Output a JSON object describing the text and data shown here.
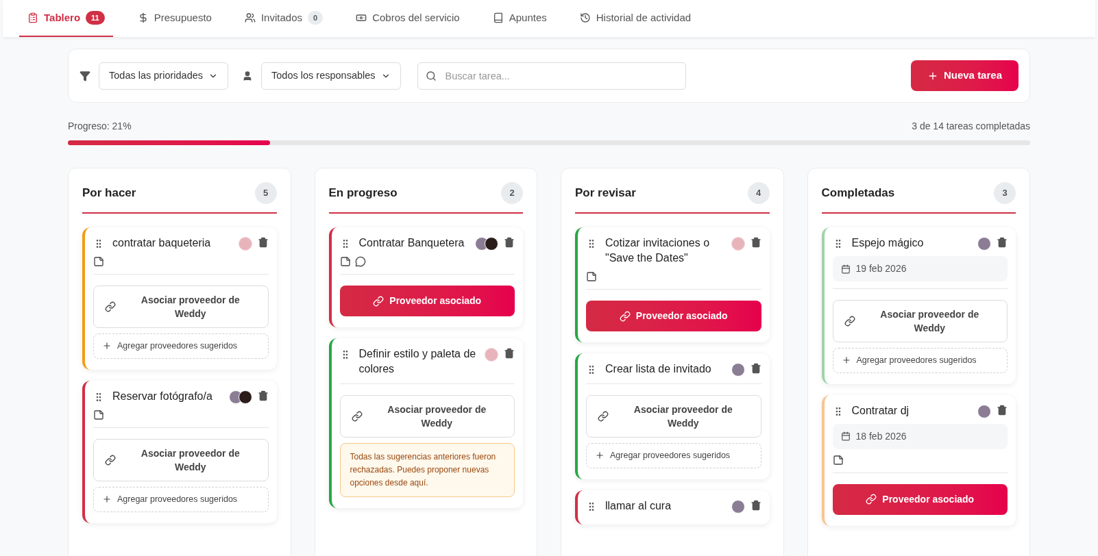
{
  "tabs": [
    {
      "label": "Tablero",
      "badge": "11",
      "selected": true
    },
    {
      "label": "Presupuesto",
      "selected": false
    },
    {
      "label": "Invitados",
      "badge": "0",
      "selected": false
    },
    {
      "label": "Cobros del servicio",
      "selected": false
    },
    {
      "label": "Apuntes",
      "selected": false
    },
    {
      "label": "Historial de actividad",
      "selected": false
    }
  ],
  "filters": {
    "priority": "Todas las prioridades",
    "responsible": "Todos los responsables",
    "search_placeholder": "Buscar tarea...",
    "new_task": "Nueva tarea"
  },
  "progress": {
    "label": "Progreso: 21%",
    "summary": "3 de 14 tareas completadas",
    "level": 0.21
  },
  "columns": [
    {
      "title": "Por hacer",
      "count": "5",
      "cards": [
        {
          "title": "contratar baqueteria",
          "color": "#f39c12",
          "avatars": [
            {
              "kind": "logo"
            }
          ],
          "note": true,
          "comment": false,
          "provider": {
            "kind": "unlinked",
            "label": "Asociar proveedor de Weddy"
          },
          "suggest": "Agregar proveedores sugeridos"
        },
        {
          "title": "Reservar fotógrafo/a",
          "color": "#d12f45",
          "avatars": [
            {
              "kind": "photo"
            },
            {
              "kind": "dark"
            }
          ],
          "note": true,
          "comment": false,
          "provider": {
            "kind": "unlinked",
            "label": "Asociar proveedor de Weddy"
          },
          "suggest": "Agregar proveedores sugeridos"
        }
      ]
    },
    {
      "title": "En progreso",
      "count": "2",
      "cards": [
        {
          "title": "Contratar Banquetera",
          "color": "#d12f45",
          "avatars": [
            {
              "kind": "photo"
            },
            {
              "kind": "dark"
            }
          ],
          "note": true,
          "comment": true,
          "provider": {
            "kind": "linked",
            "label": "Proveedor asociado"
          }
        },
        {
          "title": "Definir estilo y paleta de colores",
          "color": "#28a745",
          "avatars": [
            {
              "kind": "logo"
            }
          ],
          "note": false,
          "comment": false,
          "provider": {
            "kind": "unlinked",
            "label": "Asociar proveedor de Weddy"
          },
          "warning": "Todas las sugerencias anteriores fueron rechazadas. Puedes proponer nuevas opciones desde aquí."
        }
      ]
    },
    {
      "title": "Por revisar",
      "count": "4",
      "cards": [
        {
          "title": "Cotizar invitaciones o \"Save the Dates\"",
          "color": "#28a745",
          "avatars": [
            {
              "kind": "logo"
            }
          ],
          "note": true,
          "comment": false,
          "provider": {
            "kind": "linked",
            "label": "Proveedor asociado"
          }
        },
        {
          "title": "Crear lista de invitado",
          "color": "#28a745",
          "avatars": [
            {
              "kind": "photo"
            }
          ],
          "note": false,
          "comment": false,
          "provider": {
            "kind": "unlinked",
            "label": "Asociar proveedor de Weddy"
          },
          "suggest": "Agregar proveedores sugeridos"
        },
        {
          "title": "llamar al cura",
          "color": "#d12f45",
          "avatars": [
            {
              "kind": "photo"
            }
          ],
          "note": false,
          "comment": false
        }
      ]
    },
    {
      "title": "Completadas",
      "count": "3",
      "cards": [
        {
          "title": "Espejo mágico",
          "color": "#9fd3a8",
          "avatars": [
            {
              "kind": "photo"
            }
          ],
          "date": "19 feb 2026",
          "note": false,
          "comment": false,
          "provider": {
            "kind": "unlinked",
            "label": "Asociar proveedor de Weddy"
          },
          "suggest": "Agregar proveedores sugeridos"
        },
        {
          "title": "Contratar dj",
          "color": "#f8c58f",
          "avatars": [
            {
              "kind": "photo"
            }
          ],
          "date": "18 feb 2026",
          "note": true,
          "comment": false,
          "provider": {
            "kind": "linked",
            "label": "Proveedor asociado"
          }
        }
      ]
    }
  ]
}
